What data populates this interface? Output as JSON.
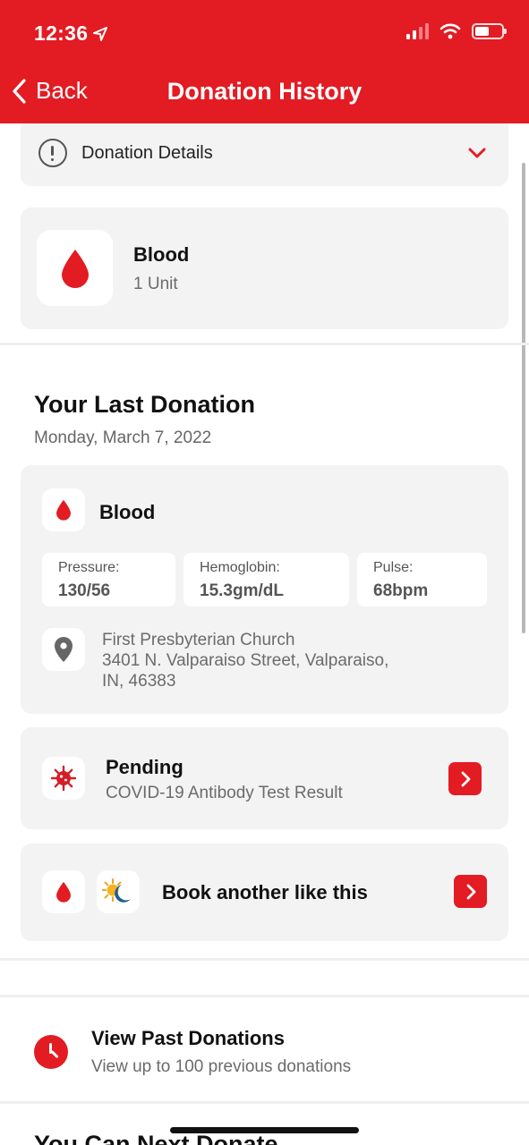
{
  "status_bar": {
    "time": "12:36",
    "location_icon": "location-arrow-icon",
    "battery_level": 0.55
  },
  "nav": {
    "back_label": "Back",
    "title": "Donation History"
  },
  "colors": {
    "brand_red": "#e31b23",
    "card_bg": "#f3f3f3",
    "muted_text": "#6b6b6b"
  },
  "donation_details": {
    "label": "Donation Details",
    "icon": "info-icon"
  },
  "blood_summary": {
    "title": "Blood",
    "quantity": "1 Unit",
    "icon": "blood-drop-icon"
  },
  "last_donation": {
    "heading": "Your Last Donation",
    "date": "Monday, March 7, 2022",
    "type_label": "Blood",
    "stats": [
      {
        "label": "Pressure:",
        "value": "130/56"
      },
      {
        "label": "Hemoglobin:",
        "value": "15.3gm/dL"
      },
      {
        "label": "Pulse:",
        "value": "68bpm"
      }
    ],
    "location": {
      "name": "First Presbyterian Church",
      "address_line1": "3401 N. Valparaiso Street, Valparaiso,",
      "address_line2": "IN, 46383"
    }
  },
  "test_result": {
    "status": "Pending",
    "description": "COVID-19 Antibody Test Result",
    "icon": "virus-icon"
  },
  "book_again": {
    "label": "Book another like this",
    "icons": [
      "blood-drop-icon",
      "sun-moon-icon"
    ]
  },
  "past_donations": {
    "title": "View Past Donations",
    "subtitle": "View up to 100 previous donations",
    "icon": "clock-icon"
  },
  "next_section": {
    "heading": "You Can Next Donate"
  }
}
